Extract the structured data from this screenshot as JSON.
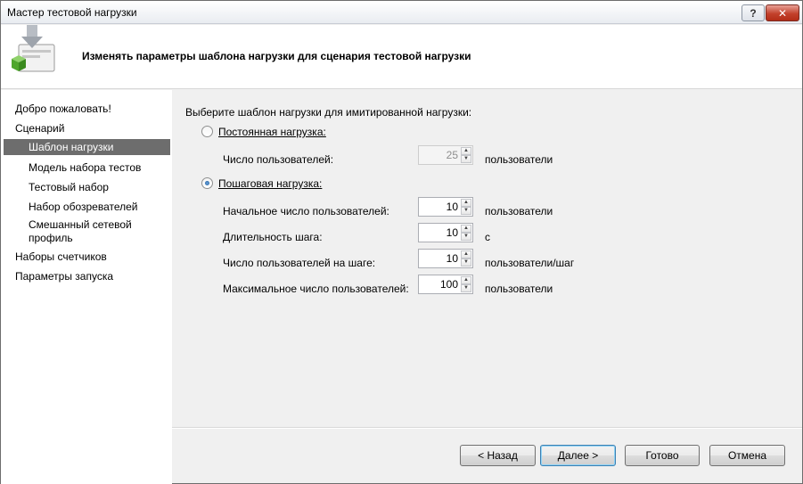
{
  "window": {
    "title": "Мастер тестовой нагрузки"
  },
  "header": {
    "heading": "Изменять параметры шаблона нагрузки для сценария тестовой нагрузки"
  },
  "sidebar": {
    "items": [
      {
        "label": "Добро пожаловать!"
      },
      {
        "label": "Сценарий"
      },
      {
        "label": "Шаблон нагрузки",
        "selected": true
      },
      {
        "label": "Модель набора тестов"
      },
      {
        "label": "Тестовый набор"
      },
      {
        "label": "Набор обозревателей"
      },
      {
        "label_line1": "Смешанный сетевой",
        "label_line2": "профиль"
      },
      {
        "label": "Наборы счетчиков"
      },
      {
        "label": "Параметры запуска"
      }
    ]
  },
  "main": {
    "prompt": "Выберите шаблон нагрузки для имитированной нагрузки:",
    "constant": {
      "label": "Постоянная нагрузка:",
      "selected": false,
      "users_label": "Число пользователей:",
      "users_value": "25",
      "users_unit": "пользователи"
    },
    "step": {
      "label": "Пошаговая нагрузка:",
      "selected": true,
      "fields": [
        {
          "label": "Начальное число пользователей:",
          "value": "10",
          "unit": "пользователи"
        },
        {
          "label": "Длительность шага:",
          "value": "10",
          "unit": "с"
        },
        {
          "label": "Число пользователей на шаге:",
          "value": "10",
          "unit": "пользователи/шаг"
        },
        {
          "label": "Максимальное число пользователей:",
          "value": "100",
          "unit": "пользователи"
        }
      ]
    }
  },
  "footer": {
    "back": "< Назад",
    "next": "Далее >",
    "finish": "Готово",
    "cancel": "Отмена"
  },
  "colors": {
    "selected_nav": "#6d6d6d",
    "accent_radio": "#1f5e9c"
  }
}
